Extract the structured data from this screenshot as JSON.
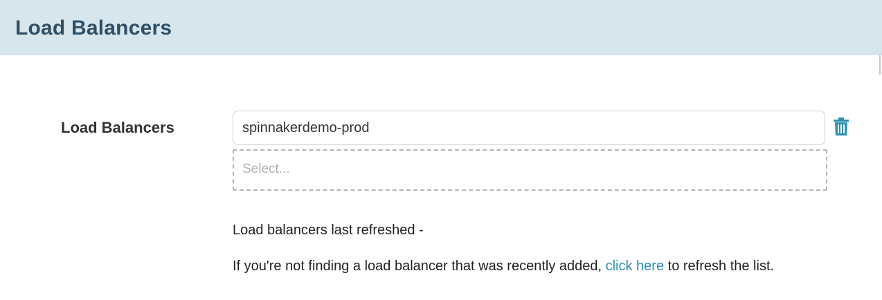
{
  "header": {
    "title": "Load Balancers"
  },
  "form": {
    "label": "Load Balancers",
    "selected_value": "spinnakerdemo-prod",
    "select_placeholder": "Select...",
    "remove_icon": "trash-icon"
  },
  "info": {
    "last_refreshed": "Load balancers last refreshed -",
    "refresh_prefix": "If you're not finding a load balancer that was recently added,",
    "refresh_link": "click here",
    "refresh_suffix": "to refresh the list."
  },
  "colors": {
    "header_bg": "#d6e6ec",
    "header_text": "#2e4f66",
    "accent": "#2a8fb0"
  }
}
